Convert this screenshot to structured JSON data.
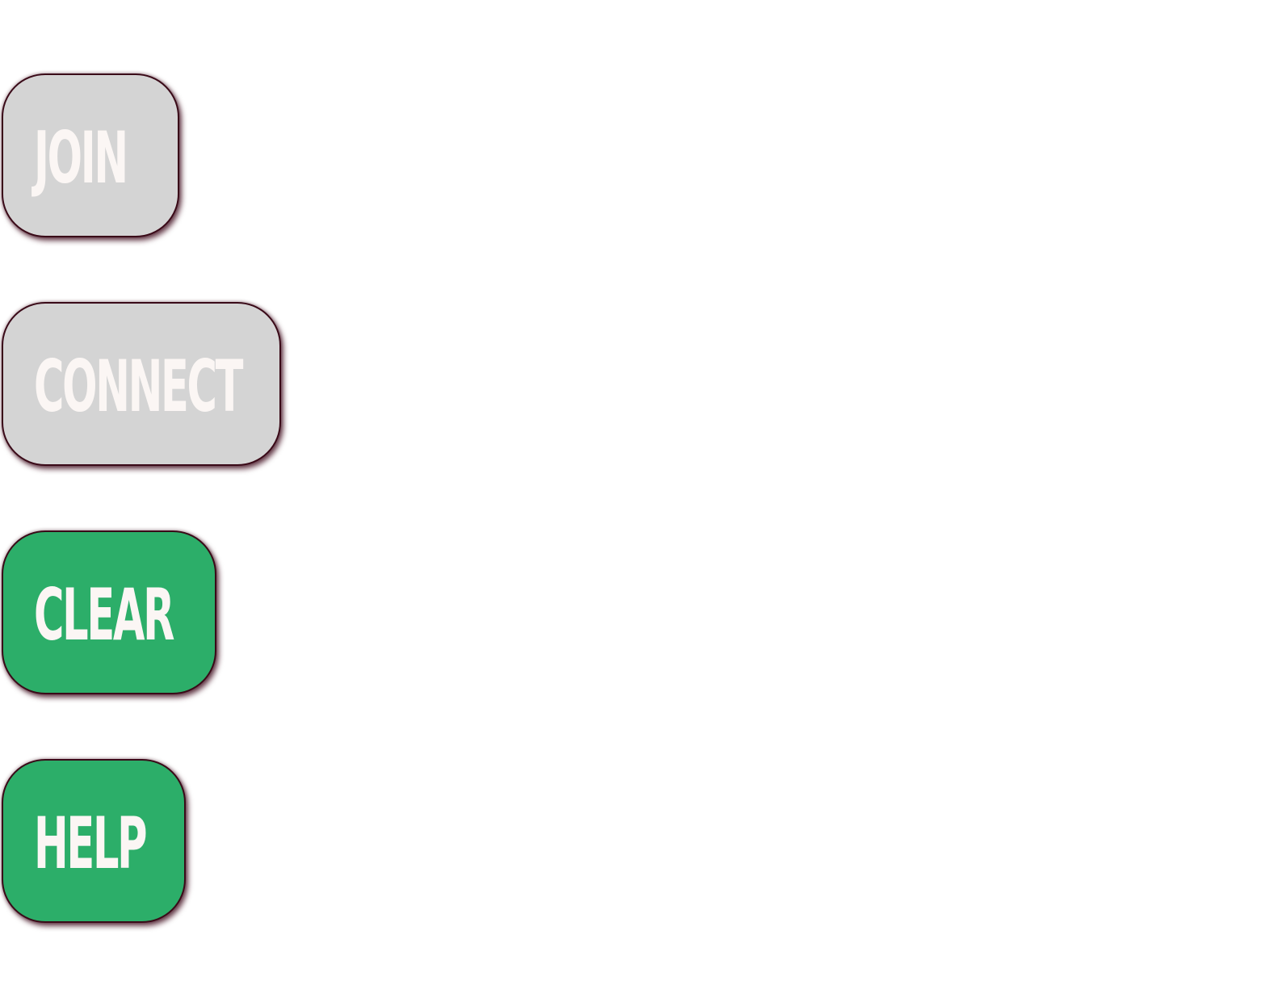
{
  "buttons": {
    "join": {
      "label": "JOIN",
      "state": "disabled",
      "color": "#d4d4d4"
    },
    "connect": {
      "label": "CONNECT",
      "state": "disabled",
      "color": "#d4d4d4"
    },
    "clear": {
      "label": "CLEAR",
      "state": "enabled",
      "color": "#2cae69"
    },
    "help": {
      "label": "HELP",
      "state": "enabled",
      "color": "#2cae69"
    }
  },
  "colors": {
    "label_text": "#fbf6f4",
    "border": "#3a0a18",
    "background": "#ffffff"
  }
}
